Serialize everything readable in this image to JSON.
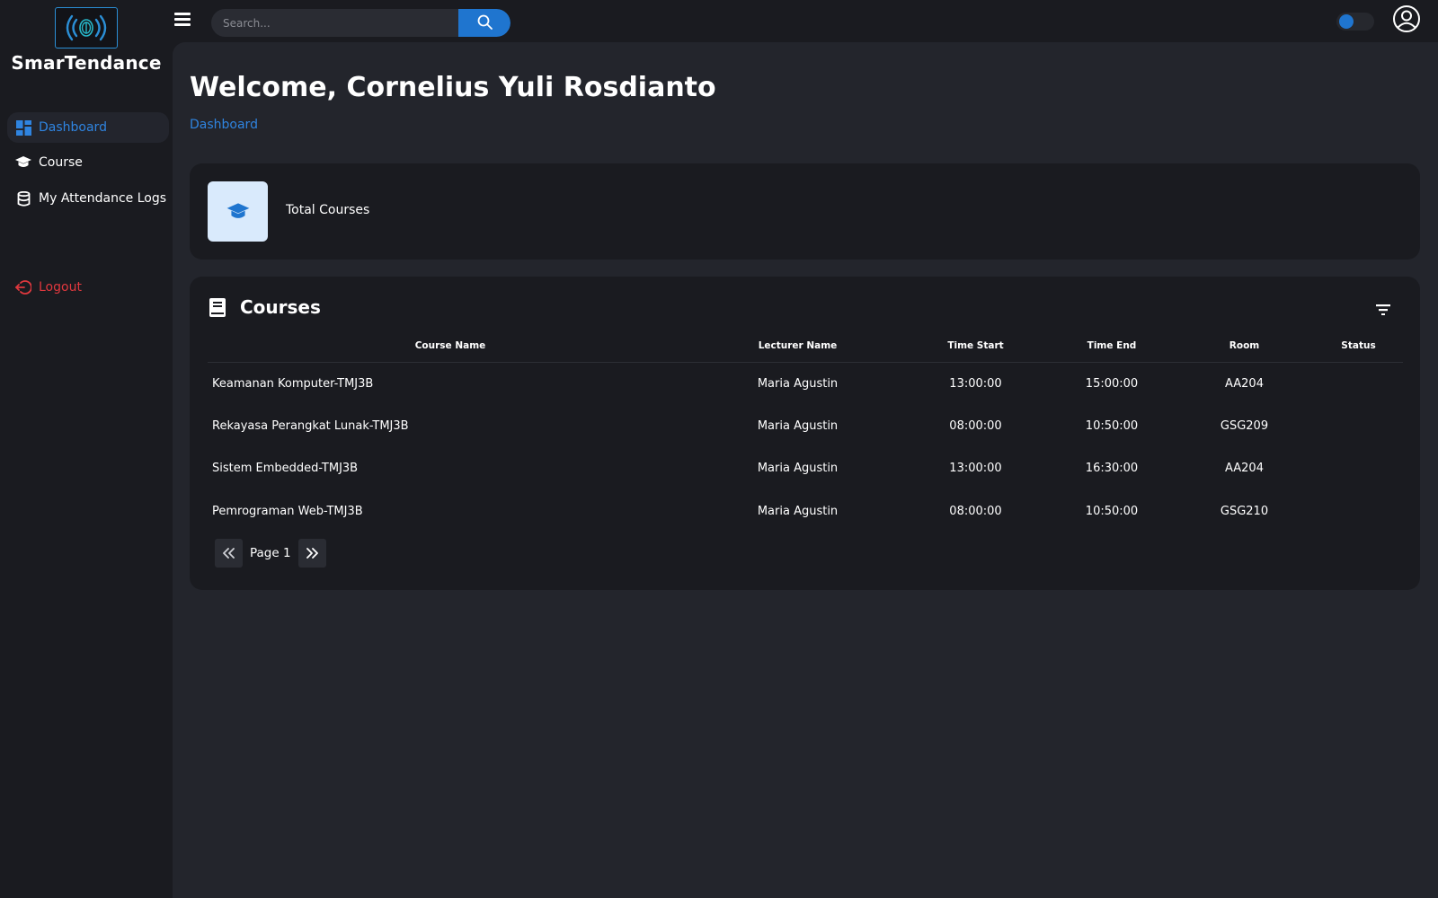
{
  "app": {
    "brand": "SmarTendance",
    "accent": "#1f75cf",
    "danger": "#e0383e"
  },
  "sidebar": {
    "items": [
      {
        "label": "Dashboard",
        "icon": "dashboard-icon",
        "active": true
      },
      {
        "label": "Course",
        "icon": "graduation-cap-icon",
        "active": false
      },
      {
        "label": "My Attendance Logs",
        "icon": "database-icon",
        "active": false
      }
    ],
    "logout_label": "Logout"
  },
  "topbar": {
    "search_placeholder": "Search...",
    "theme_toggle": "on"
  },
  "header": {
    "welcome": "Welcome, Cornelius Yuli Rosdianto",
    "breadcrumb": "Dashboard"
  },
  "stats": {
    "total_courses_label": "Total Courses"
  },
  "courses": {
    "title": "Courses",
    "columns": [
      "Course Name",
      "Lecturer Name",
      "Time Start",
      "Time End",
      "Room",
      "Status"
    ],
    "rows": [
      [
        "Keamanan Komputer-TMJ3B",
        "Maria Agustin",
        "13:00:00",
        "15:00:00",
        "AA204",
        ""
      ],
      [
        "Rekayasa Perangkat Lunak-TMJ3B",
        "Maria Agustin",
        "08:00:00",
        "10:50:00",
        "GSG209",
        ""
      ],
      [
        "Sistem Embedded-TMJ3B",
        "Maria Agustin",
        "13:00:00",
        "16:30:00",
        "AA204",
        ""
      ],
      [
        "Pemrograman Web-TMJ3B",
        "Maria Agustin",
        "08:00:00",
        "10:50:00",
        "GSG210",
        ""
      ]
    ],
    "page_label": "Page 1"
  }
}
